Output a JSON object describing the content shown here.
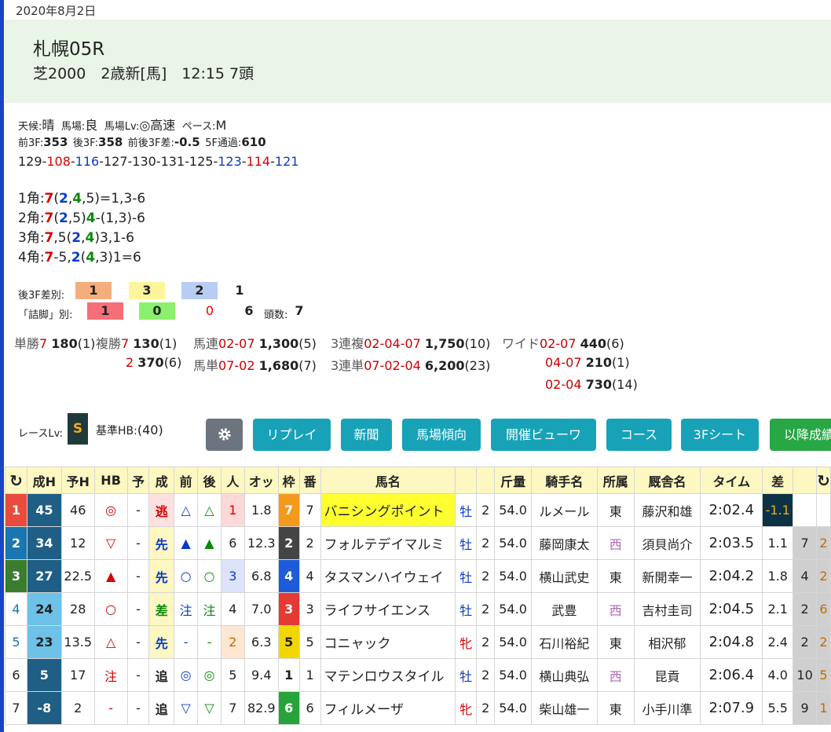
{
  "date": "2020年8月2日",
  "race": {
    "title": "札幌05R",
    "sub": "芝2000　2歳新[馬]　12:15 7頭"
  },
  "cond": {
    "weather_l": "天候:",
    "weather": "晴",
    "track_l": "馬場:",
    "track": "良",
    "lv_l": "馬場Lv:",
    "lv": "◎高速",
    "pace_l": "ペース:",
    "pace": "M"
  },
  "times": {
    "f3_l": "前3F:",
    "f3": "353",
    "l3_l": "後3F:",
    "l3": "358",
    "diff_l": "前後3F差:",
    "diff": "-0.5",
    "f5_l": "5F通過:",
    "f5": "610"
  },
  "laps": [
    {
      "t": "129",
      "c": "k"
    },
    {
      "t": "-"
    },
    {
      "t": "108",
      "c": "r"
    },
    {
      "t": "-"
    },
    {
      "t": "116",
      "c": "b"
    },
    {
      "t": "-127-130-131-125-"
    },
    {
      "t": "123",
      "c": "b"
    },
    {
      "t": "-"
    },
    {
      "t": "114",
      "c": "r"
    },
    {
      "t": "-"
    },
    {
      "t": "121",
      "c": "b"
    }
  ],
  "corners": [
    [
      {
        "t": "1角:"
      },
      {
        "t": "7",
        "c": "r",
        "b": 1
      },
      {
        "t": "("
      },
      {
        "t": "2",
        "c": "b",
        "b": 1
      },
      {
        "t": ","
      },
      {
        "t": "4",
        "c": "g",
        "b": 1
      },
      {
        "t": ",5)=1,3-6"
      }
    ],
    [
      {
        "t": "2角:"
      },
      {
        "t": "7",
        "c": "r",
        "b": 1
      },
      {
        "t": "("
      },
      {
        "t": "2",
        "c": "b",
        "b": 1
      },
      {
        "t": ",5)"
      },
      {
        "t": "4",
        "c": "g",
        "b": 1
      },
      {
        "t": "-(1,3)-6"
      }
    ],
    [
      {
        "t": "3角:"
      },
      {
        "t": "7",
        "c": "r",
        "b": 1
      },
      {
        "t": ",5("
      },
      {
        "t": "2",
        "c": "b",
        "b": 1
      },
      {
        "t": ","
      },
      {
        "t": "4",
        "c": "g",
        "b": 1
      },
      {
        "t": ")3,1-6"
      }
    ],
    [
      {
        "t": "4角:"
      },
      {
        "t": "7",
        "c": "r",
        "b": 1
      },
      {
        "t": "-5,"
      },
      {
        "t": "2",
        "c": "b",
        "b": 1
      },
      {
        "t": "("
      },
      {
        "t": "4",
        "c": "g",
        "b": 1
      },
      {
        "t": ",3)1=6"
      }
    ]
  ],
  "stats": {
    "l3_label": "後3F差別:",
    "l3_vals": [
      "1",
      "3",
      "2",
      "1"
    ],
    "tsume_label": "「詰脚」別:",
    "ts_vals": [
      "1",
      "0",
      "0",
      "6"
    ],
    "count_label": "頭数:",
    "count": "7"
  },
  "payouts": {
    "tan_l": "単勝",
    "tan_n": "7",
    "tan_v": "180",
    "tan_p": "(1)",
    "fuku_l": "複勝",
    "fuku_n1": "7",
    "fuku_v1": "130",
    "fuku_p1": "(1)",
    "fuku_n2": "2",
    "fuku_v2": "370",
    "fuku_p2": "(6)",
    "baren_l": "馬連",
    "baren_n": "02-07",
    "baren_v": "1,300",
    "baren_p": "(5)",
    "batan_l": "馬単",
    "batan_n": "07-02",
    "batan_v": "1,680",
    "batan_p": "(7)",
    "trio_l": "3連複",
    "trio_n": "02-04-07",
    "trio_v": "1,750",
    "trio_p": "(10)",
    "tri_l": "3連単",
    "tri_n": "07-02-04",
    "tri_v": "6,200",
    "tri_p": "(23)",
    "wide_l": "ワイド",
    "wide": [
      {
        "n": "02-07",
        "v": "440",
        "p": "(6)"
      },
      {
        "n": "04-07",
        "v": "210",
        "p": "(1)"
      },
      {
        "n": "02-04",
        "v": "730",
        "p": "(14)"
      }
    ]
  },
  "lv": {
    "label": "レースLv:",
    "value": "S",
    "hb_label": "基準HB:",
    "hb": "(40)"
  },
  "buttons": [
    "リプレイ",
    "新聞",
    "馬場傾向",
    "開催ビューワ",
    "コース",
    "3Fシート",
    "以降成績"
  ],
  "columns": [
    "成H",
    "予H",
    "HB",
    "予",
    "成",
    "前",
    "後",
    "人",
    "オッ",
    "枠",
    "番",
    "馬名",
    "",
    "",
    "斤量",
    "騎手名",
    "所属",
    "厩舎名",
    "タイム",
    "差",
    ""
  ],
  "rows": [
    {
      "rank": "1",
      "seih": "45",
      "yoh": "46",
      "hb": "◎",
      "yo": "-",
      "sei": "逃",
      "mae": "△",
      "ato": "△",
      "pop": "1",
      "odds": "1.8",
      "waku": "7",
      "ban": "7",
      "name": "バニシングポイント",
      "sex": "牡",
      "age": "2",
      "kin": "54.0",
      "jockey": "ルメール",
      "aff": "東",
      "trainer": "藤沢和雄",
      "time": "2:02.4",
      "diff": "-1.1",
      "x1": "",
      "x2": ""
    },
    {
      "rank": "2",
      "seih": "34",
      "yoh": "12",
      "hb": "▽",
      "yo": "-",
      "sei": "先",
      "mae": "▲",
      "ato": "▲",
      "pop": "6",
      "odds": "12.3",
      "waku": "2",
      "ban": "2",
      "name": "フォルテデイマルミ",
      "sex": "牡",
      "age": "2",
      "kin": "54.0",
      "jockey": "藤岡康太",
      "aff": "西",
      "trainer": "須貝尚介",
      "time": "2:03.5",
      "diff": "1.1",
      "x1": "7",
      "x2": "2"
    },
    {
      "rank": "3",
      "seih": "27",
      "yoh": "22.5",
      "hb": "▲",
      "yo": "-",
      "sei": "先",
      "mae": "○",
      "ato": "○",
      "pop": "3",
      "odds": "6.8",
      "waku": "4",
      "ban": "4",
      "name": "タスマンハイウェイ",
      "sex": "牡",
      "age": "2",
      "kin": "54.0",
      "jockey": "横山武史",
      "aff": "東",
      "trainer": "新開幸一",
      "time": "2:04.2",
      "diff": "1.8",
      "x1": "4",
      "x2": "2"
    },
    {
      "rank": "4",
      "seih": "24",
      "yoh": "28",
      "hb": "○",
      "yo": "-",
      "sei": "差",
      "mae": "注",
      "ato": "注",
      "pop": "4",
      "odds": "7.0",
      "waku": "3",
      "ban": "3",
      "name": "ライフサイエンス",
      "sex": "牡",
      "age": "2",
      "kin": "54.0",
      "jockey": "武豊",
      "aff": "西",
      "trainer": "吉村圭司",
      "time": "2:04.5",
      "diff": "2.1",
      "x1": "2",
      "x2": "6"
    },
    {
      "rank": "5",
      "seih": "23",
      "yoh": "13.5",
      "hb": "△",
      "yo": "-",
      "sei": "先",
      "mae": "-",
      "ato": "-",
      "pop": "2",
      "odds": "6.3",
      "waku": "5",
      "ban": "5",
      "name": "コニャック",
      "sex": "牝",
      "age": "2",
      "kin": "54.0",
      "jockey": "石川裕紀",
      "aff": "東",
      "trainer": "相沢郁",
      "time": "2:04.8",
      "diff": "2.4",
      "x1": "2",
      "x2": "2"
    },
    {
      "rank": "6",
      "seih": "5",
      "yoh": "17",
      "hb": "注",
      "yo": "-",
      "sei": "追",
      "mae": "◎",
      "ato": "◎",
      "pop": "5",
      "odds": "9.4",
      "waku": "1",
      "ban": "1",
      "name": "マテンロウスタイル",
      "sex": "牡",
      "age": "2",
      "kin": "54.0",
      "jockey": "横山典弘",
      "aff": "西",
      "trainer": "昆貢",
      "time": "2:06.4",
      "diff": "4.0",
      "x1": "10",
      "x2": "5"
    },
    {
      "rank": "7",
      "seih": "-8",
      "yoh": "2",
      "hb": "-",
      "yo": "-",
      "sei": "追",
      "mae": "▽",
      "ato": "▽",
      "pop": "7",
      "odds": "82.9",
      "waku": "6",
      "ban": "6",
      "name": "フィルメーザ",
      "sex": "牝",
      "age": "2",
      "kin": "54.0",
      "jockey": "柴山雄一",
      "aff": "東",
      "trainer": "小手川準",
      "time": "2:07.9",
      "diff": "5.5",
      "x1": "9",
      "x2": "1"
    }
  ]
}
